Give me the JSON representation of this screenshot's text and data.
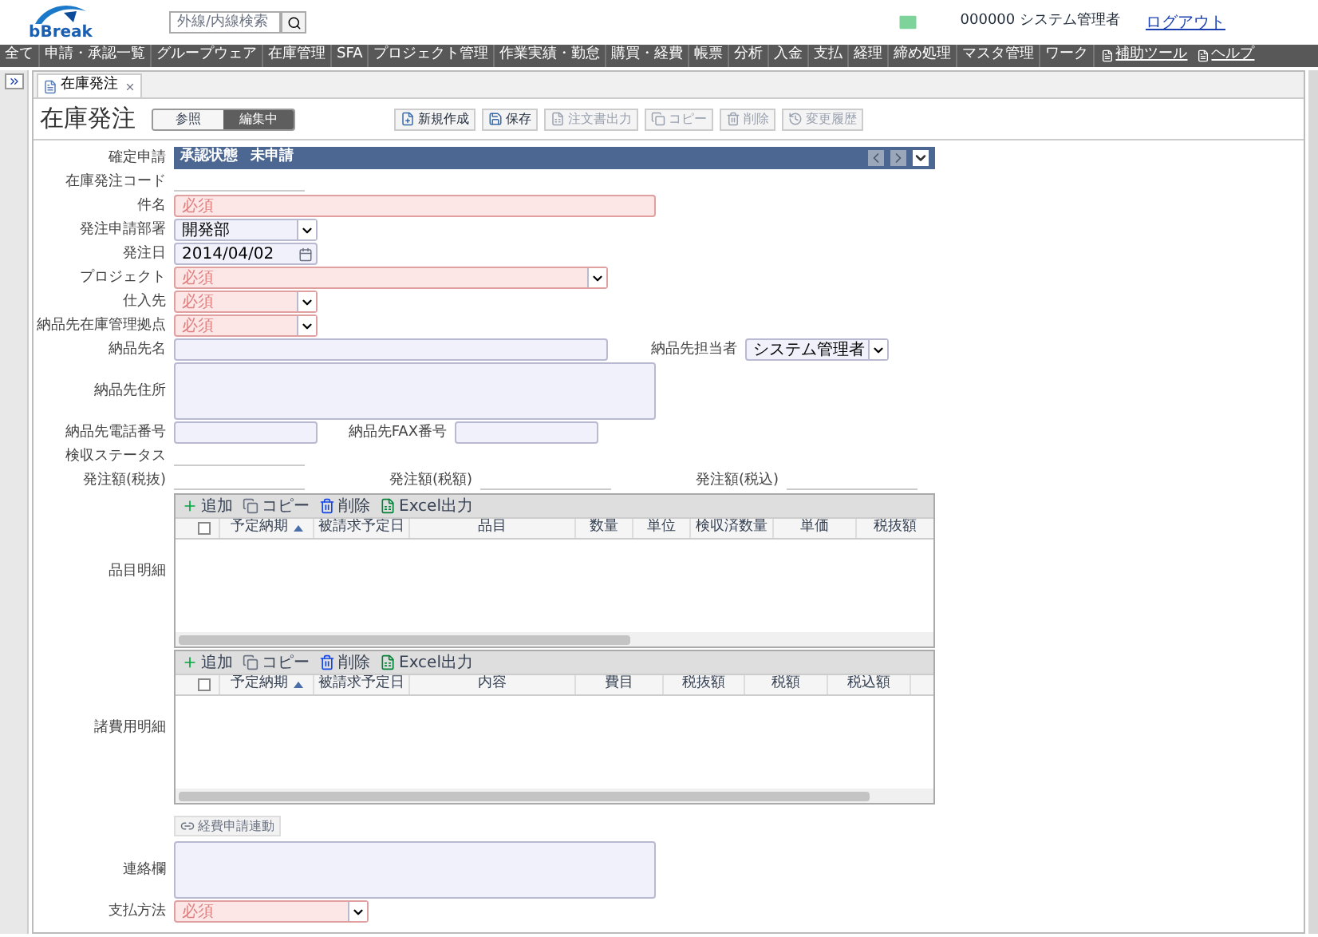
{
  "header": {
    "logo": "bBreak",
    "search": {
      "placeholder": "外線/内線検索"
    },
    "user": "000000 システム管理者",
    "logout": "ログアウト"
  },
  "nav": [
    {
      "label": "全て",
      "kind": "menu"
    },
    {
      "label": "申請・承認一覧",
      "kind": "menu"
    },
    {
      "label": "グループウェア",
      "kind": "menu"
    },
    {
      "label": "在庫管理",
      "kind": "menu"
    },
    {
      "label": "SFA",
      "kind": "menu"
    },
    {
      "label": "プロジェクト管理",
      "kind": "menu"
    },
    {
      "label": "作業実績・勤怠",
      "kind": "menu"
    },
    {
      "label": "購買・経費",
      "kind": "menu"
    },
    {
      "label": "帳票",
      "kind": "menu"
    },
    {
      "label": "分析",
      "kind": "menu"
    },
    {
      "label": "入金",
      "kind": "menu"
    },
    {
      "label": "支払",
      "kind": "menu"
    },
    {
      "label": "経理",
      "kind": "menu"
    },
    {
      "label": "締め処理",
      "kind": "menu"
    },
    {
      "label": "マスタ管理",
      "kind": "menu"
    },
    {
      "label": "ワーク",
      "kind": "menu"
    },
    {
      "label": "補助ツール",
      "kind": "link"
    },
    {
      "label": "ヘルプ",
      "kind": "link"
    }
  ],
  "tab": {
    "label": "在庫発注"
  },
  "title": "在庫発注",
  "mode_toggle": [
    {
      "label": "参照",
      "selected": false
    },
    {
      "label": "編集中",
      "selected": true
    }
  ],
  "toolbar": [
    {
      "label": "新規作成",
      "disabled": false
    },
    {
      "label": "保存",
      "disabled": false
    },
    {
      "label": "注文書出力",
      "disabled": true
    },
    {
      "label": "コピー",
      "disabled": true
    },
    {
      "label": "削除",
      "disabled": true
    },
    {
      "label": "変更履歴",
      "disabled": true
    }
  ],
  "form": [
    {
      "items": [
        {
          "label": "確定申請",
          "kind": "status",
          "status_label": "承認状態",
          "value": "未申請"
        }
      ]
    },
    {
      "items": [
        {
          "label": "在庫発注コード",
          "kind": "readonly"
        }
      ]
    },
    {
      "items": [
        {
          "label": "件名",
          "kind": "text",
          "required": true,
          "placeholder": "必須"
        }
      ]
    },
    {
      "items": [
        {
          "label": "発注申請部署",
          "kind": "select",
          "required": false,
          "value": "開発部"
        }
      ]
    },
    {
      "items": [
        {
          "label": "発注日",
          "kind": "date",
          "required": false,
          "value": "2014/04/02"
        }
      ]
    },
    {
      "items": [
        {
          "label": "プロジェクト",
          "kind": "select",
          "required": true,
          "placeholder": "必須"
        }
      ]
    },
    {
      "items": [
        {
          "label": "仕入先",
          "kind": "select",
          "required": true,
          "placeholder": "必須"
        }
      ]
    },
    {
      "items": [
        {
          "label": "納品先在庫管理拠点",
          "kind": "select",
          "required": true,
          "placeholder": "必須"
        }
      ]
    },
    {
      "items": [
        {
          "label": "納品先名",
          "kind": "text",
          "required": false
        },
        {
          "label": "納品先担当者",
          "kind": "select",
          "required": false,
          "value": "システム管理者"
        }
      ]
    },
    {
      "items": [
        {
          "label": "納品先住所",
          "kind": "textarea",
          "required": false
        }
      ]
    },
    {
      "items": [
        {
          "label": "納品先電話番号",
          "kind": "text",
          "required": false
        },
        {
          "label": "納品先FAX番号",
          "kind": "text",
          "required": false
        }
      ]
    },
    {
      "items": [
        {
          "label": "検収ステータス",
          "kind": "readonly"
        }
      ]
    },
    {
      "items": [
        {
          "label": "発注額(税抜)",
          "kind": "readonly"
        },
        {
          "label": "発注額(税額)",
          "kind": "readonly"
        },
        {
          "label": "発注額(税込)",
          "kind": "readonly"
        }
      ]
    },
    {
      "items": [
        {
          "label": "品目明細",
          "kind": "grid",
          "all_checked": false,
          "tools": [
            "追加",
            "コピー",
            "削除",
            "Excel出力"
          ],
          "columns": [
            {
              "label": "予定納期",
              "sorted": true
            },
            {
              "label": "被請求予定日",
              "sorted": false
            },
            {
              "label": "品目",
              "sorted": false
            },
            {
              "label": "数量",
              "sorted": false
            },
            {
              "label": "単位",
              "sorted": false
            },
            {
              "label": "検収済数量",
              "sorted": false
            },
            {
              "label": "単価",
              "sorted": false
            },
            {
              "label": "税抜額",
              "sorted": false
            }
          ]
        }
      ]
    },
    {
      "items": [
        {
          "label": "諸費用明細",
          "kind": "grid",
          "all_checked": false,
          "tools": [
            "追加",
            "コピー",
            "削除",
            "Excel出力"
          ],
          "columns": [
            {
              "label": "予定納期",
              "sorted": true
            },
            {
              "label": "被請求予定日",
              "sorted": false
            },
            {
              "label": "内容",
              "sorted": false
            },
            {
              "label": "費目",
              "sorted": false
            },
            {
              "label": "税抜額",
              "sorted": false
            },
            {
              "label": "税額",
              "sorted": false
            },
            {
              "label": "税込額",
              "sorted": false
            }
          ]
        }
      ]
    },
    {
      "items": [
        {
          "label": "経費申請連動",
          "kind": "button"
        }
      ]
    },
    {
      "items": [
        {
          "label": "連絡欄",
          "kind": "textarea",
          "required": false
        }
      ]
    },
    {
      "items": [
        {
          "label": "支払方法",
          "kind": "select",
          "required": true,
          "placeholder": "必須"
        }
      ]
    }
  ]
}
